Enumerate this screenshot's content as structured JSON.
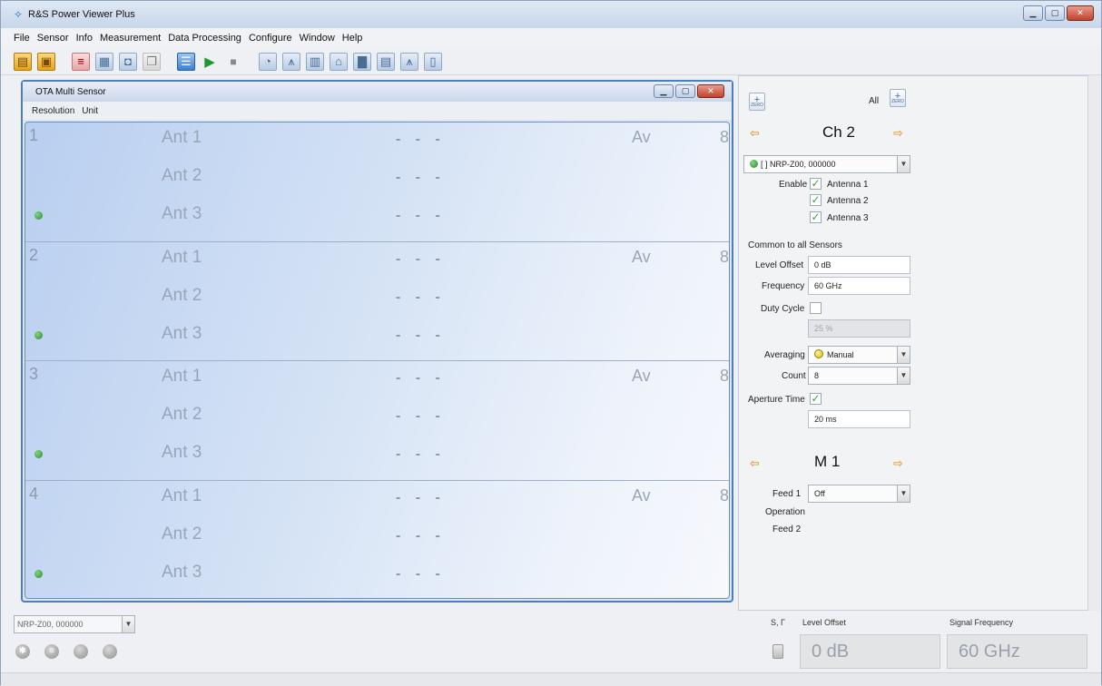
{
  "app": {
    "title": "R&S Power Viewer Plus"
  },
  "menu": [
    "File",
    "Sensor",
    "Info",
    "Measurement",
    "Data Processing",
    "Configure",
    "Window",
    "Help"
  ],
  "inner_window": {
    "title": "OTA Multi Sensor",
    "menu": [
      "Resolution",
      "Unit"
    ],
    "groups": [
      {
        "number": "1",
        "mode": "Av",
        "count": "8",
        "antennas": [
          "Ant 1",
          "Ant 2",
          "Ant 3"
        ],
        "value": "- - -"
      },
      {
        "number": "2",
        "mode": "Av",
        "count": "8",
        "antennas": [
          "Ant 1",
          "Ant 2",
          "Ant 3"
        ],
        "value": "- - -"
      },
      {
        "number": "3",
        "mode": "Av",
        "count": "8",
        "antennas": [
          "Ant 1",
          "Ant 2",
          "Ant 3"
        ],
        "value": "- - -"
      },
      {
        "number": "4",
        "mode": "Av",
        "count": "8",
        "antennas": [
          "Ant 1",
          "Ant 2",
          "Ant 3"
        ],
        "value": "- - -"
      }
    ]
  },
  "bottom_left": {
    "sensor_select": "NRP-Z00, 000000"
  },
  "panel": {
    "zero_label": "ZERO",
    "all_label": "All",
    "channel": "Ch 2",
    "sensor_combo": "[ ] NRP-Z00, 000000",
    "enable_label": "Enable",
    "antennas": [
      "Antenna 1",
      "Antenna 2",
      "Antenna 3"
    ],
    "common_label": "Common to all Sensors",
    "level_offset_label": "Level Offset",
    "level_offset_value": "0 dB",
    "frequency_label": "Frequency",
    "frequency_value": "60 GHz",
    "duty_cycle_label": "Duty Cycle",
    "duty_cycle_value": "25 %",
    "averaging_label": "Averaging",
    "averaging_value": "Manual",
    "count_label": "Count",
    "count_value": "8",
    "aperture_label": "Aperture Time",
    "aperture_value": "20 ms",
    "math_channel": "M 1",
    "feed1_label": "Feed 1",
    "feed1_value": "Off",
    "operation_label": "Operation",
    "feed2_label": "Feed 2"
  },
  "readouts": {
    "s_gamma_label": "S, Γ",
    "level_offset_label": "Level Offset",
    "level_offset_value": "0 dB",
    "signal_frequency_label": "Signal Frequency",
    "signal_frequency_value": "60 GHz"
  }
}
